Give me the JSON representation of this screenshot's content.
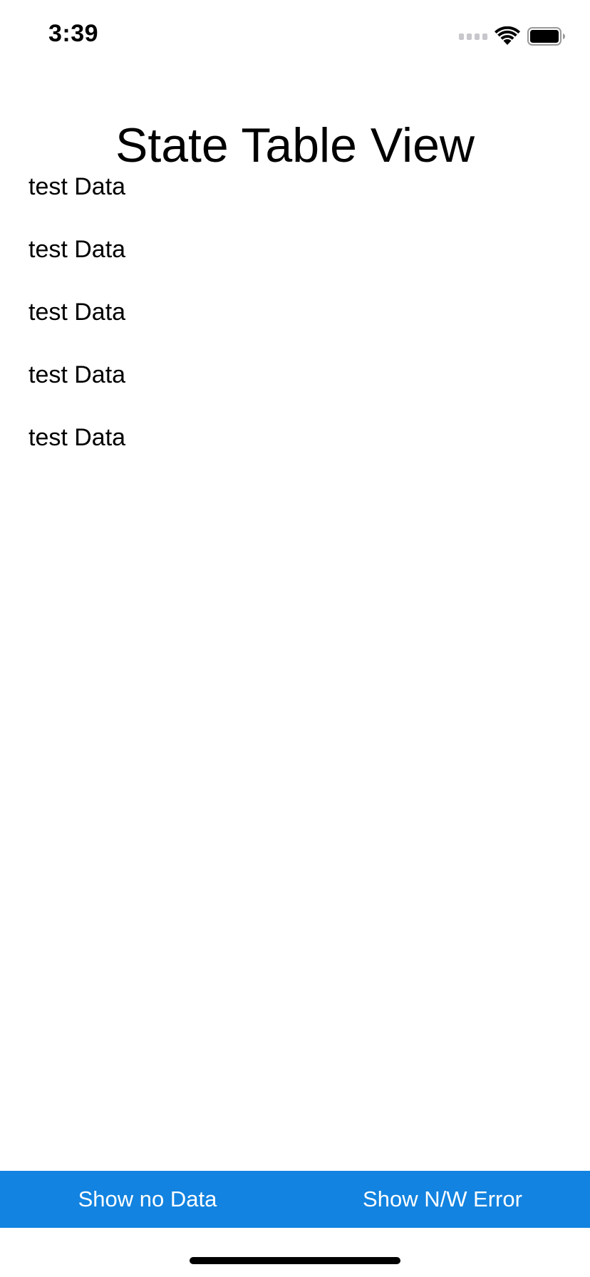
{
  "status_bar": {
    "time": "3:39",
    "icons": [
      "cellular-signal-icon",
      "wifi-icon",
      "battery-icon"
    ]
  },
  "page": {
    "title": "State Table View"
  },
  "list": {
    "items": [
      {
        "label": "test Data"
      },
      {
        "label": "test Data"
      },
      {
        "label": "test Data"
      },
      {
        "label": "test Data"
      },
      {
        "label": "test Data"
      }
    ]
  },
  "toolbar": {
    "show_no_data_label": "Show no Data",
    "show_nw_error_label": "Show N/W Error",
    "background_color": "#1283e0"
  }
}
